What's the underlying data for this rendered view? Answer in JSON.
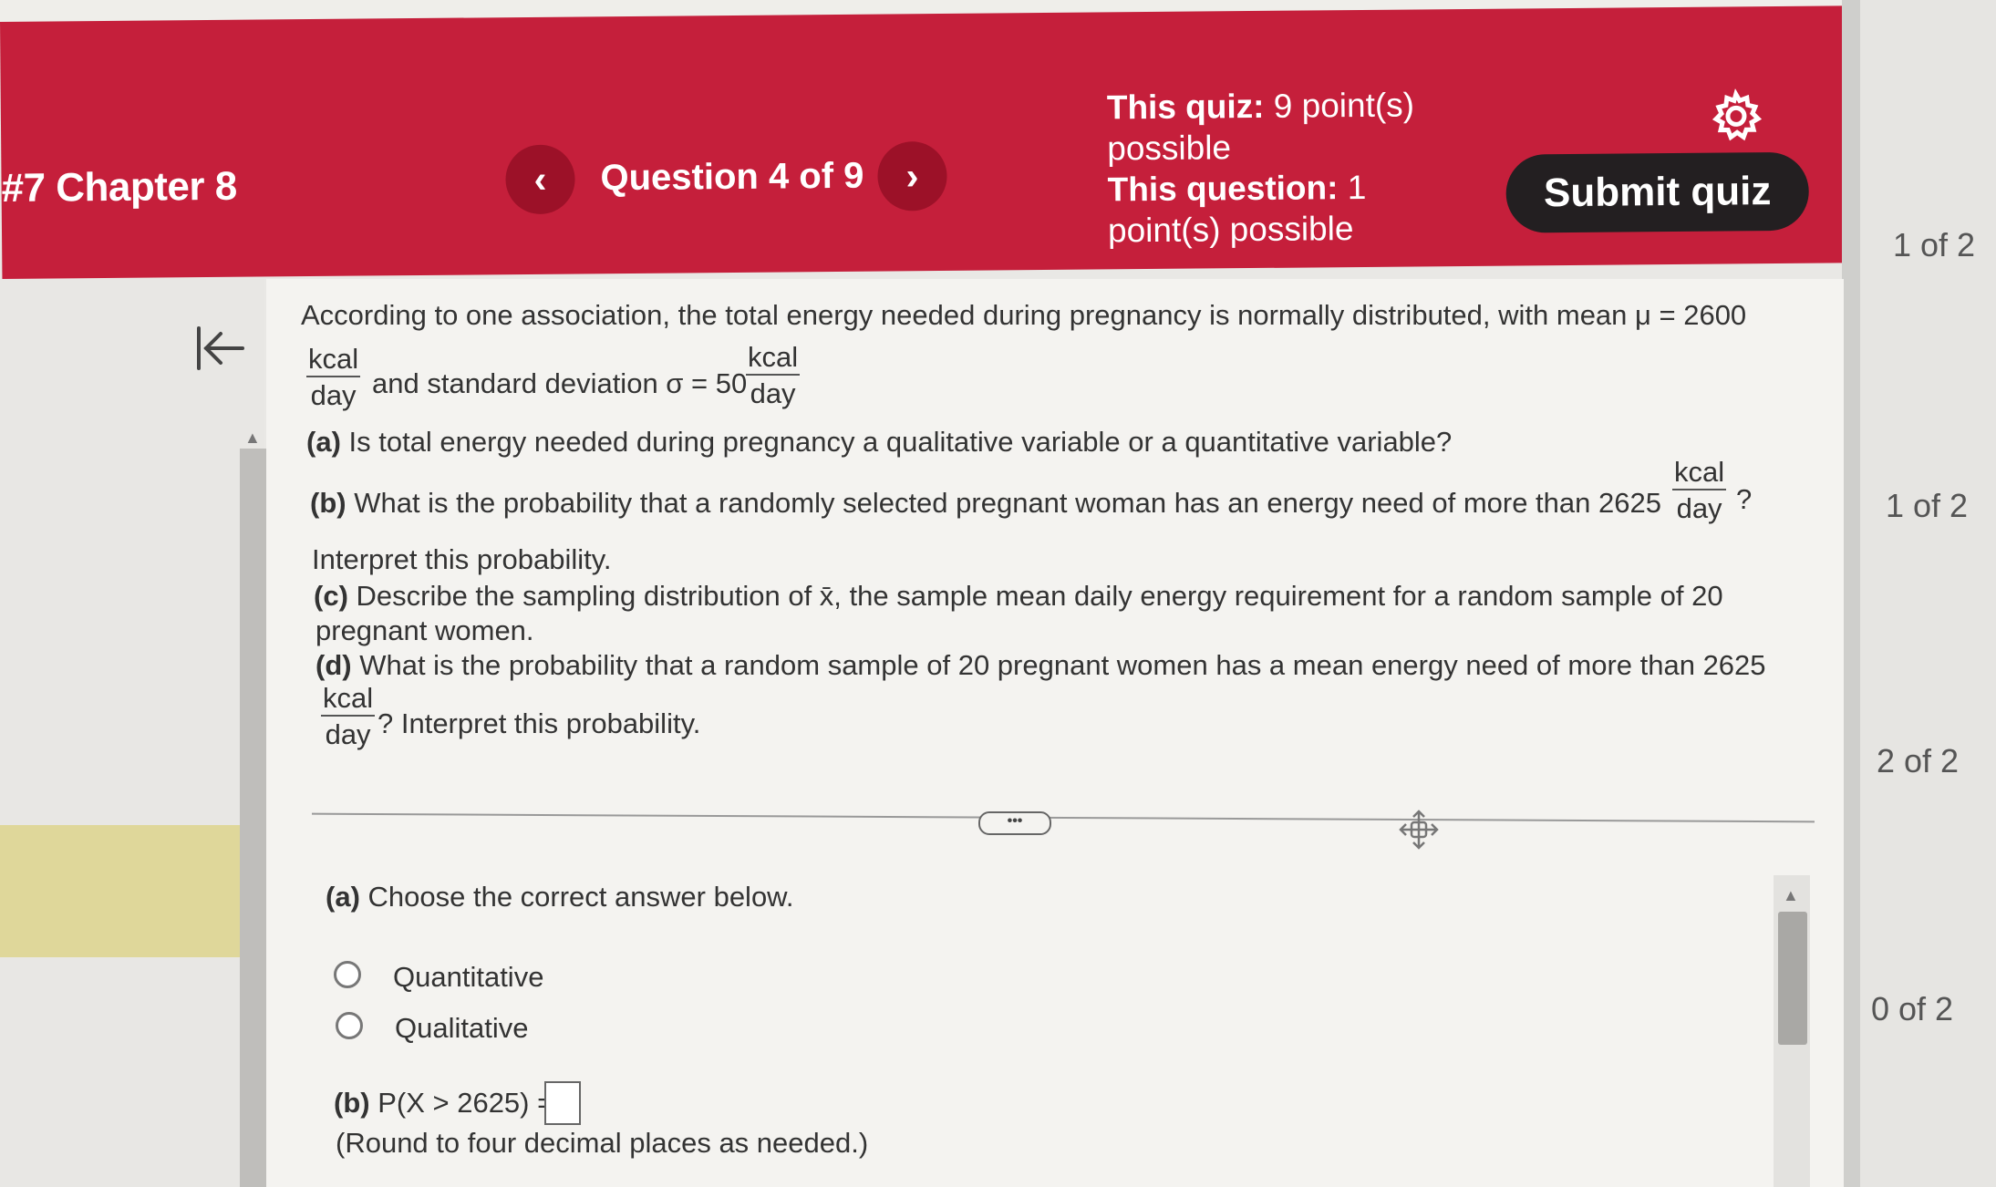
{
  "header": {
    "chapter_title": "#7 Chapter 8",
    "question_counter": "Question 4 of 9",
    "prev_label": "‹",
    "next_label": "›",
    "quiz_points_bold": "This quiz:",
    "quiz_points_rest": " 9 point(s)",
    "quiz_points_line2": "possible",
    "question_points_bold": "This question:",
    "question_points_rest": " 1",
    "question_points_line2": "point(s) possible",
    "submit_label": "Submit quiz",
    "accent_color": "#c51f3b"
  },
  "sidebar_scores": [
    "1 of 2",
    "1 of 2",
    "2 of 2",
    "0 of 2"
  ],
  "question": {
    "intro_line1": "According to one association, the total energy needed during pregnancy is normally distributed, with mean μ = 2600",
    "intro_mid": "and standard deviation σ = 50",
    "unit_num": "kcal",
    "unit_den": "day",
    "a_label": "(a)",
    "a_text": " Is total energy needed during pregnancy a qualitative variable or a quantitative variable?",
    "b_label": "(b)",
    "b_text": " What is the probability that a randomly selected pregnant woman has an energy need of more than 2625",
    "b_end": "?",
    "b_interpret": "Interpret this probability.",
    "c_label": "(c)",
    "c_text": " Describe the sampling distribution of x̄, the sample mean daily energy requirement for a random sample of 20",
    "c_line2": "pregnant women.",
    "d_label": "(d)",
    "d_text": " What is the probability that a random sample of 20 pregnant women has a mean energy need of more than 2625",
    "d_end": "? Interpret this probability."
  },
  "divider_dots": "•••",
  "answer": {
    "a_label": "(a)",
    "a_prompt": " Choose the correct answer below.",
    "options": [
      "Quantitative",
      "Qualitative"
    ],
    "b_label": "(b)",
    "b_expr": " P(X > 2625) =",
    "b_hint": "(Round to four decimal places as needed.)"
  }
}
